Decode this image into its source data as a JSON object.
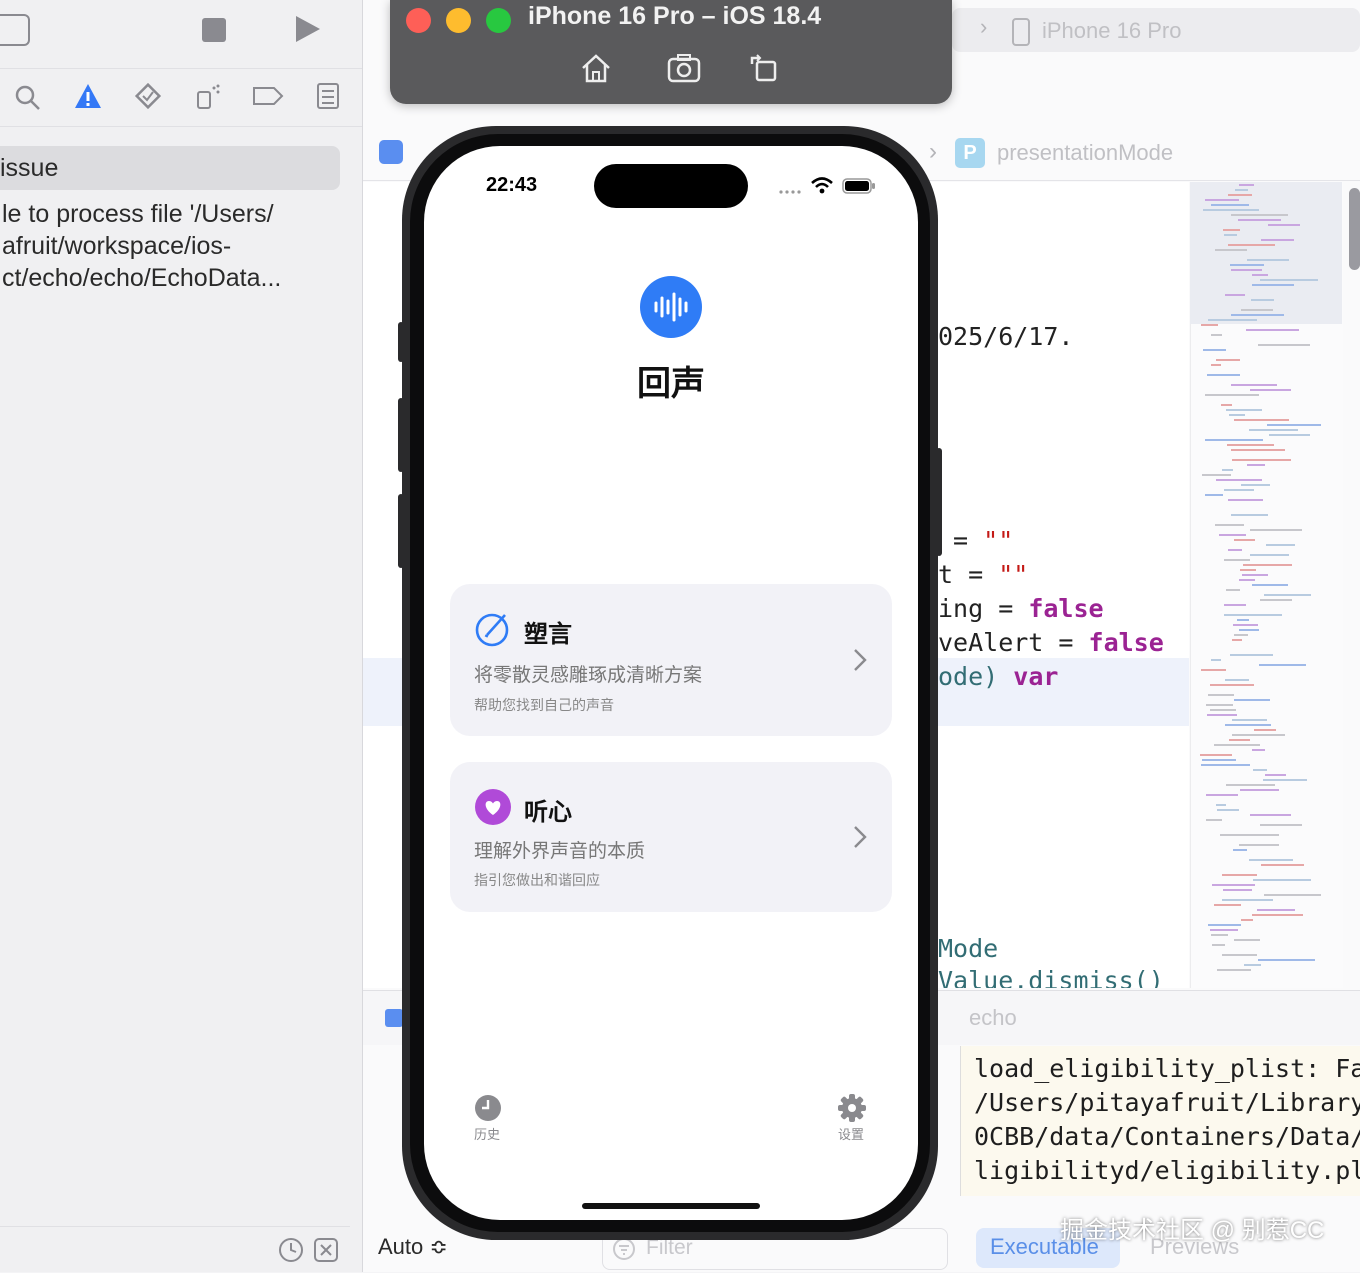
{
  "simulator": {
    "title": "iPhone 16 Pro – iOS 18.4",
    "icons": [
      "home-icon",
      "screenshot-icon",
      "rotate-icon"
    ]
  },
  "xcode": {
    "issue_navigator": {
      "section": "issue",
      "message": "le to process file '/Users/\nafruit/workspace/ios-\nct/echo/echo/EchoData..."
    },
    "run_destination": "iPhone 16 Pro",
    "breadcrumb_symbol": "presentationMode",
    "code_lines": [
      {
        "text": "025/6/17."
      },
      {
        "text": " = ",
        "value": "\"\""
      },
      {
        "text": "t = ",
        "value": "\"\""
      },
      {
        "text": "ing = ",
        "value": "false"
      },
      {
        "text": "veAlert = ",
        "value": "false"
      },
      {
        "text": "ode) ",
        "value": "var"
      },
      {
        "text": "Mode"
      },
      {
        "text": "Value.dismiss()"
      }
    ],
    "debug_target": "echo",
    "console_lines": [
      "load_eligibility_plist: Fa",
      "/Users/pitayafruit/Library",
      "0CBB/data/Containers/Data/",
      "ligibilityd/eligibility.pl"
    ],
    "variables_scope": "Auto ≎",
    "filter_placeholder": "Filter",
    "bottom_tabs": {
      "executable": "Executable",
      "previews": "Previews"
    },
    "watermark": "掘金技术社区 @ 别惹CC"
  },
  "app": {
    "status_time": "22:43",
    "name": "回声",
    "cards": [
      {
        "title": "塑言",
        "subtitle": "将零散灵感雕琢成清晰方案",
        "hint": "帮助您找到自己的声音",
        "icon": "pen-circle-icon",
        "accent": "#2f7cf6"
      },
      {
        "title": "听心",
        "subtitle": "理解外界声音的本质",
        "hint": "指引您做出和谐回应",
        "icon": "heart-circle-icon",
        "accent": "#b04ad8"
      }
    ],
    "tabs": {
      "history": "历史",
      "settings": "设置"
    }
  },
  "colors": {
    "accent": "#2f7cf6",
    "purple": "#b04ad8",
    "keyword": "#9b2393",
    "string": "#c41a16"
  }
}
